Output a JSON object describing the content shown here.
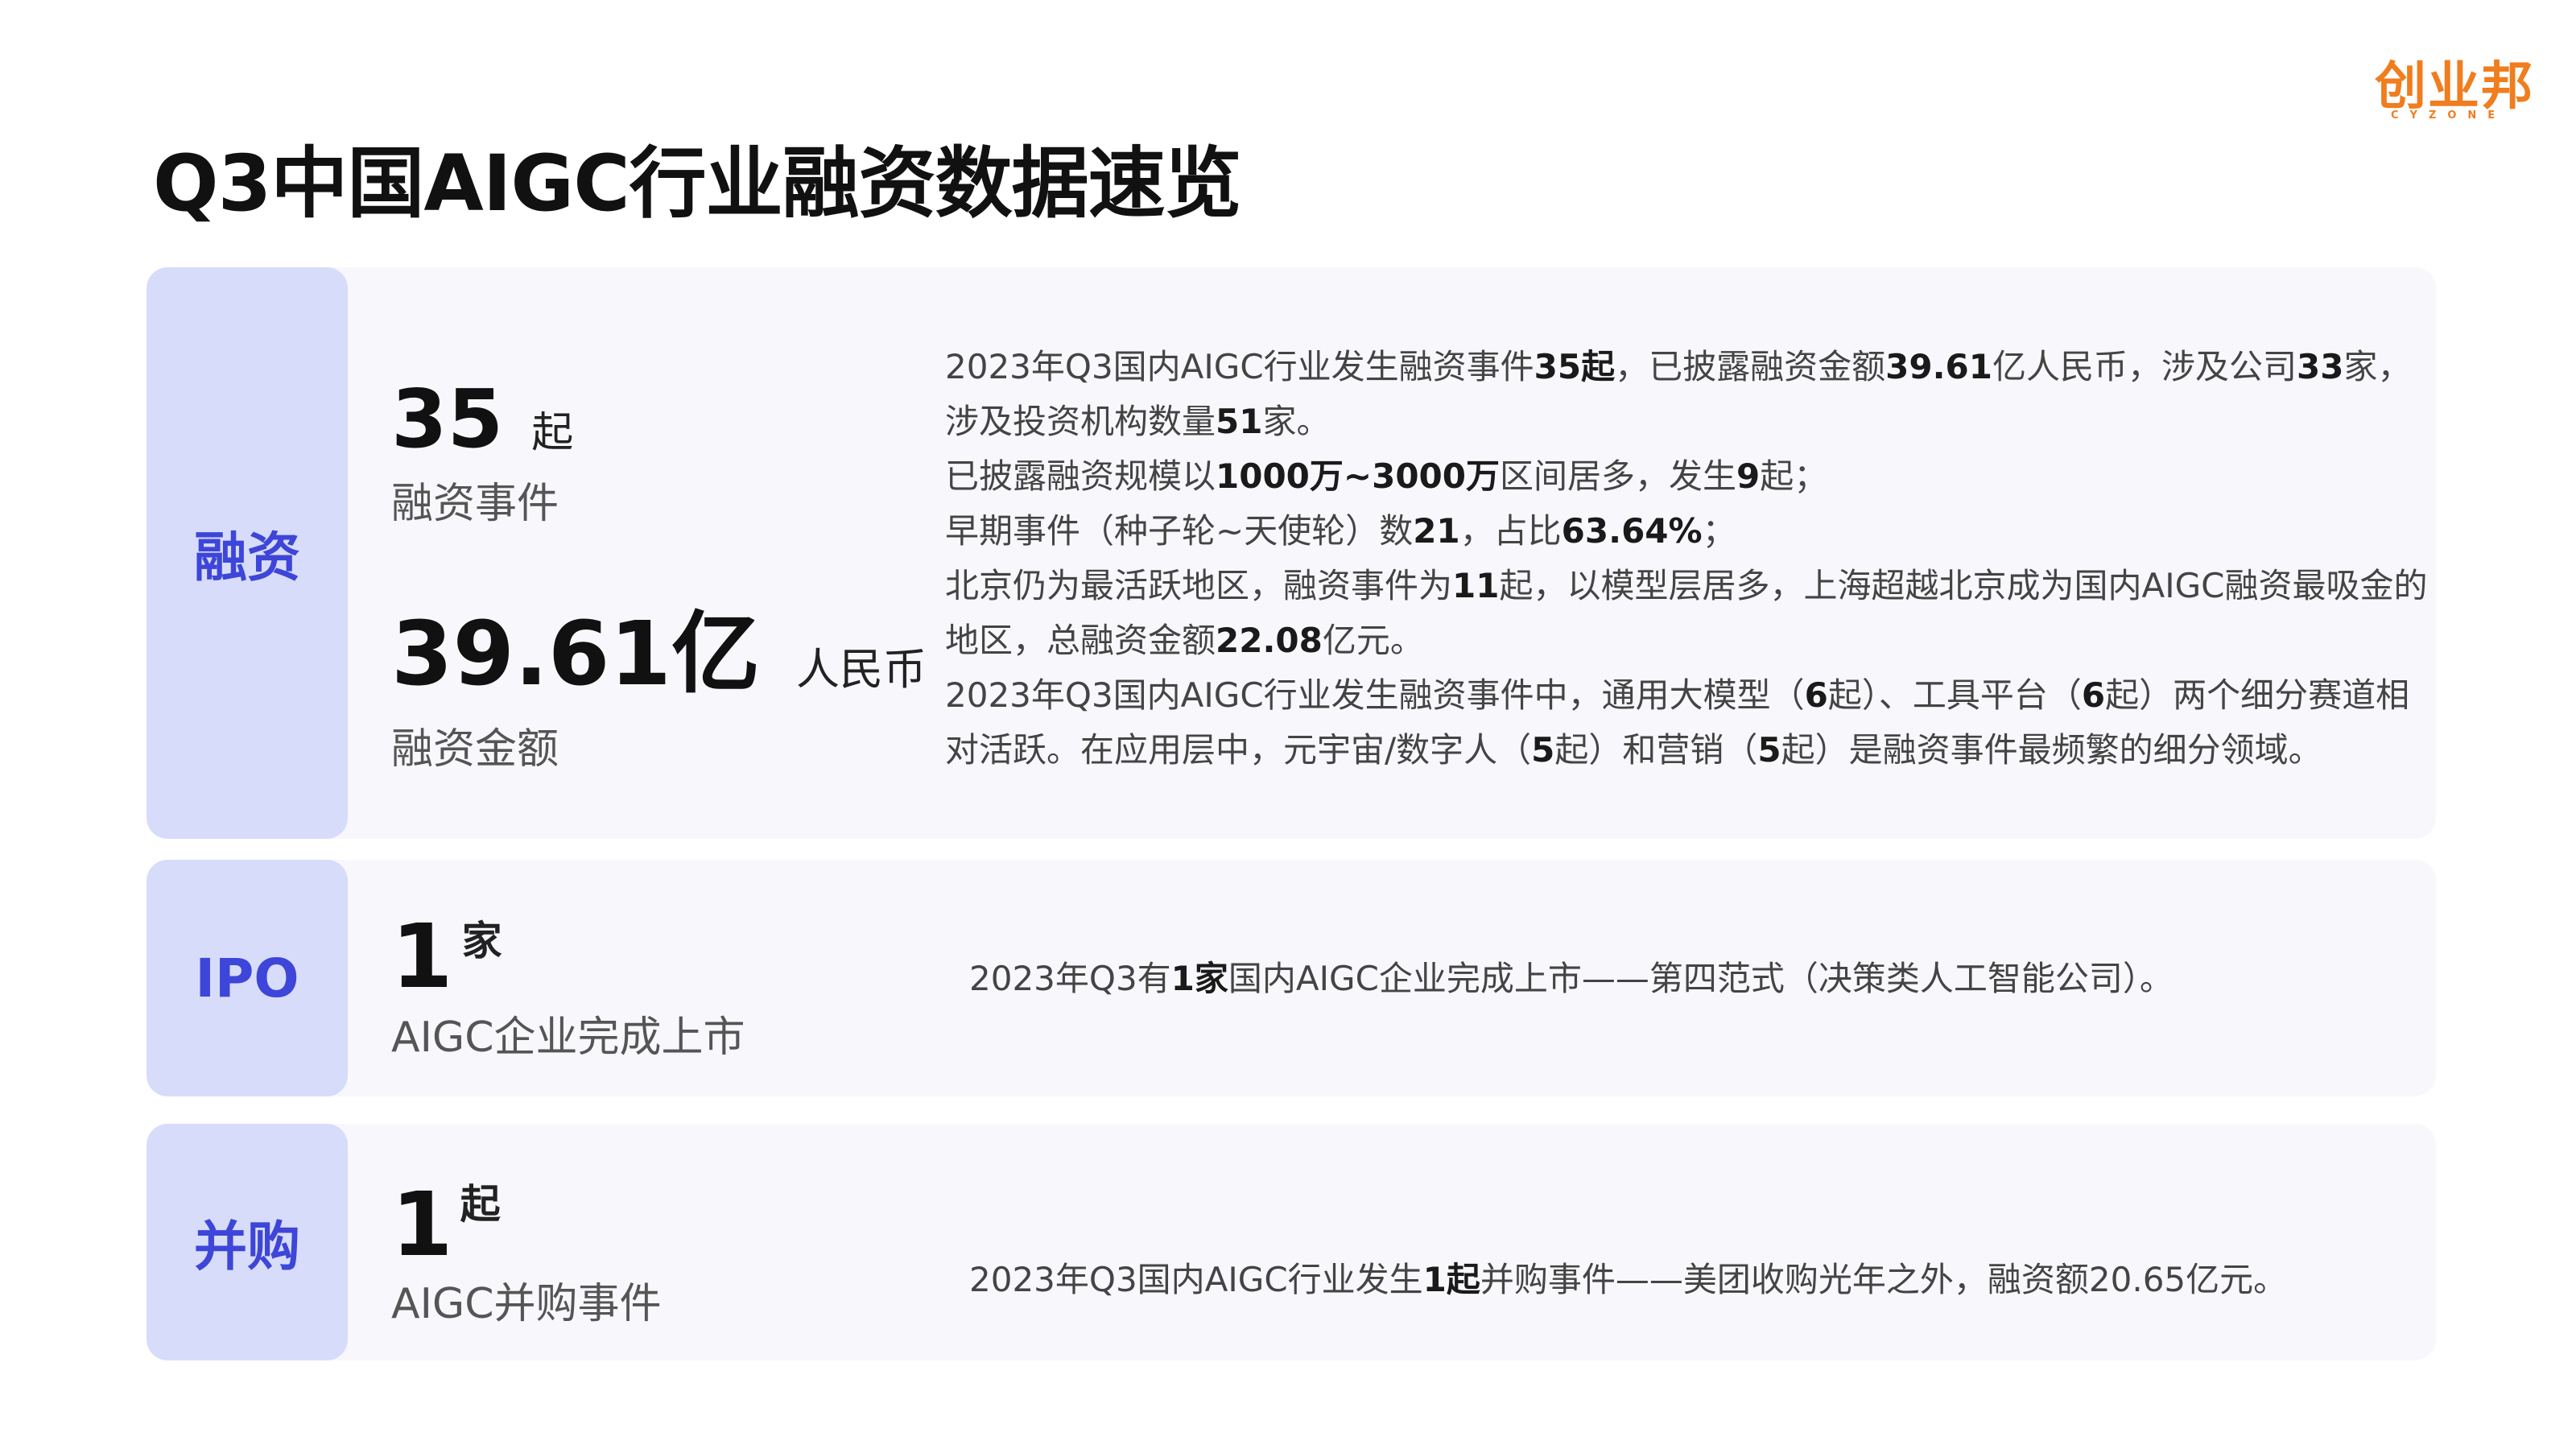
{
  "title": "Q3中国AIGC行业融资数据速览",
  "logo": {
    "main": "创业邦",
    "sub": "CYZONE"
  },
  "financing": {
    "label": "融资",
    "events": {
      "number": "35",
      "unit": "起",
      "caption": "融资事件"
    },
    "amount": {
      "number": "39.61亿",
      "unit": "人民币",
      "caption": "融资金额"
    },
    "paragraphs": [
      [
        {
          "t": "2023年Q3国内AIGC行业发生融资事件"
        },
        {
          "t": "35起",
          "b": true
        },
        {
          "t": "，已披露融资金额"
        },
        {
          "t": "39.61",
          "b": true
        },
        {
          "t": "亿人民币，涉及公司"
        },
        {
          "t": "33",
          "b": true
        },
        {
          "t": "家，涉及投资机构数量"
        },
        {
          "t": "51",
          "b": true
        },
        {
          "t": "家。"
        }
      ],
      [
        {
          "t": "已披露融资规模以"
        },
        {
          "t": "1000万~3000万",
          "b": true
        },
        {
          "t": "区间居多，发生"
        },
        {
          "t": "9",
          "b": true
        },
        {
          "t": "起；"
        }
      ],
      [
        {
          "t": "早期事件（种子轮~天使轮）数"
        },
        {
          "t": "21",
          "b": true
        },
        {
          "t": "，占比"
        },
        {
          "t": "63.64%",
          "b": true
        },
        {
          "t": "；"
        }
      ],
      [
        {
          "t": "北京仍为最活跃地区，融资事件为"
        },
        {
          "t": "11",
          "b": true
        },
        {
          "t": "起，以模型层居多，上海超越北京成为国内AIGC融资最吸金的地区，总融资金额"
        },
        {
          "t": "22.08",
          "b": true
        },
        {
          "t": "亿元。"
        }
      ],
      [
        {
          "t": "2023年Q3国内AIGC行业发生融资事件中，通用大模型（"
        },
        {
          "t": "6",
          "b": true
        },
        {
          "t": "起）、工具平台（"
        },
        {
          "t": "6",
          "b": true
        },
        {
          "t": "起）两个细分赛道相对活跃。在应用层中，元宇宙/数字人（"
        },
        {
          "t": "5",
          "b": true
        },
        {
          "t": "起）和营销（"
        },
        {
          "t": "5",
          "b": true
        },
        {
          "t": "起）是融资事件最频繁的细分领域。"
        }
      ]
    ]
  },
  "ipo": {
    "label": "IPO",
    "metric": {
      "number": "1",
      "unit": "家",
      "caption": "AIGC企业完成上市"
    },
    "paragraphs": [
      [
        {
          "t": "2023年Q3有"
        },
        {
          "t": "1家",
          "b": true
        },
        {
          "t": "国内AIGC企业完成上市——第四范式（决策类人工智能公司）。"
        }
      ]
    ]
  },
  "ma": {
    "label": "并购",
    "metric": {
      "number": "1",
      "unit": "起",
      "caption": "AIGC并购事件"
    },
    "paragraphs": [
      [
        {
          "t": "2023年Q3国内AIGC行业发生"
        },
        {
          "t": "1起",
          "b": true
        },
        {
          "t": "并购事件——美团收购光年之外，融资额20.65亿元。"
        }
      ]
    ]
  }
}
